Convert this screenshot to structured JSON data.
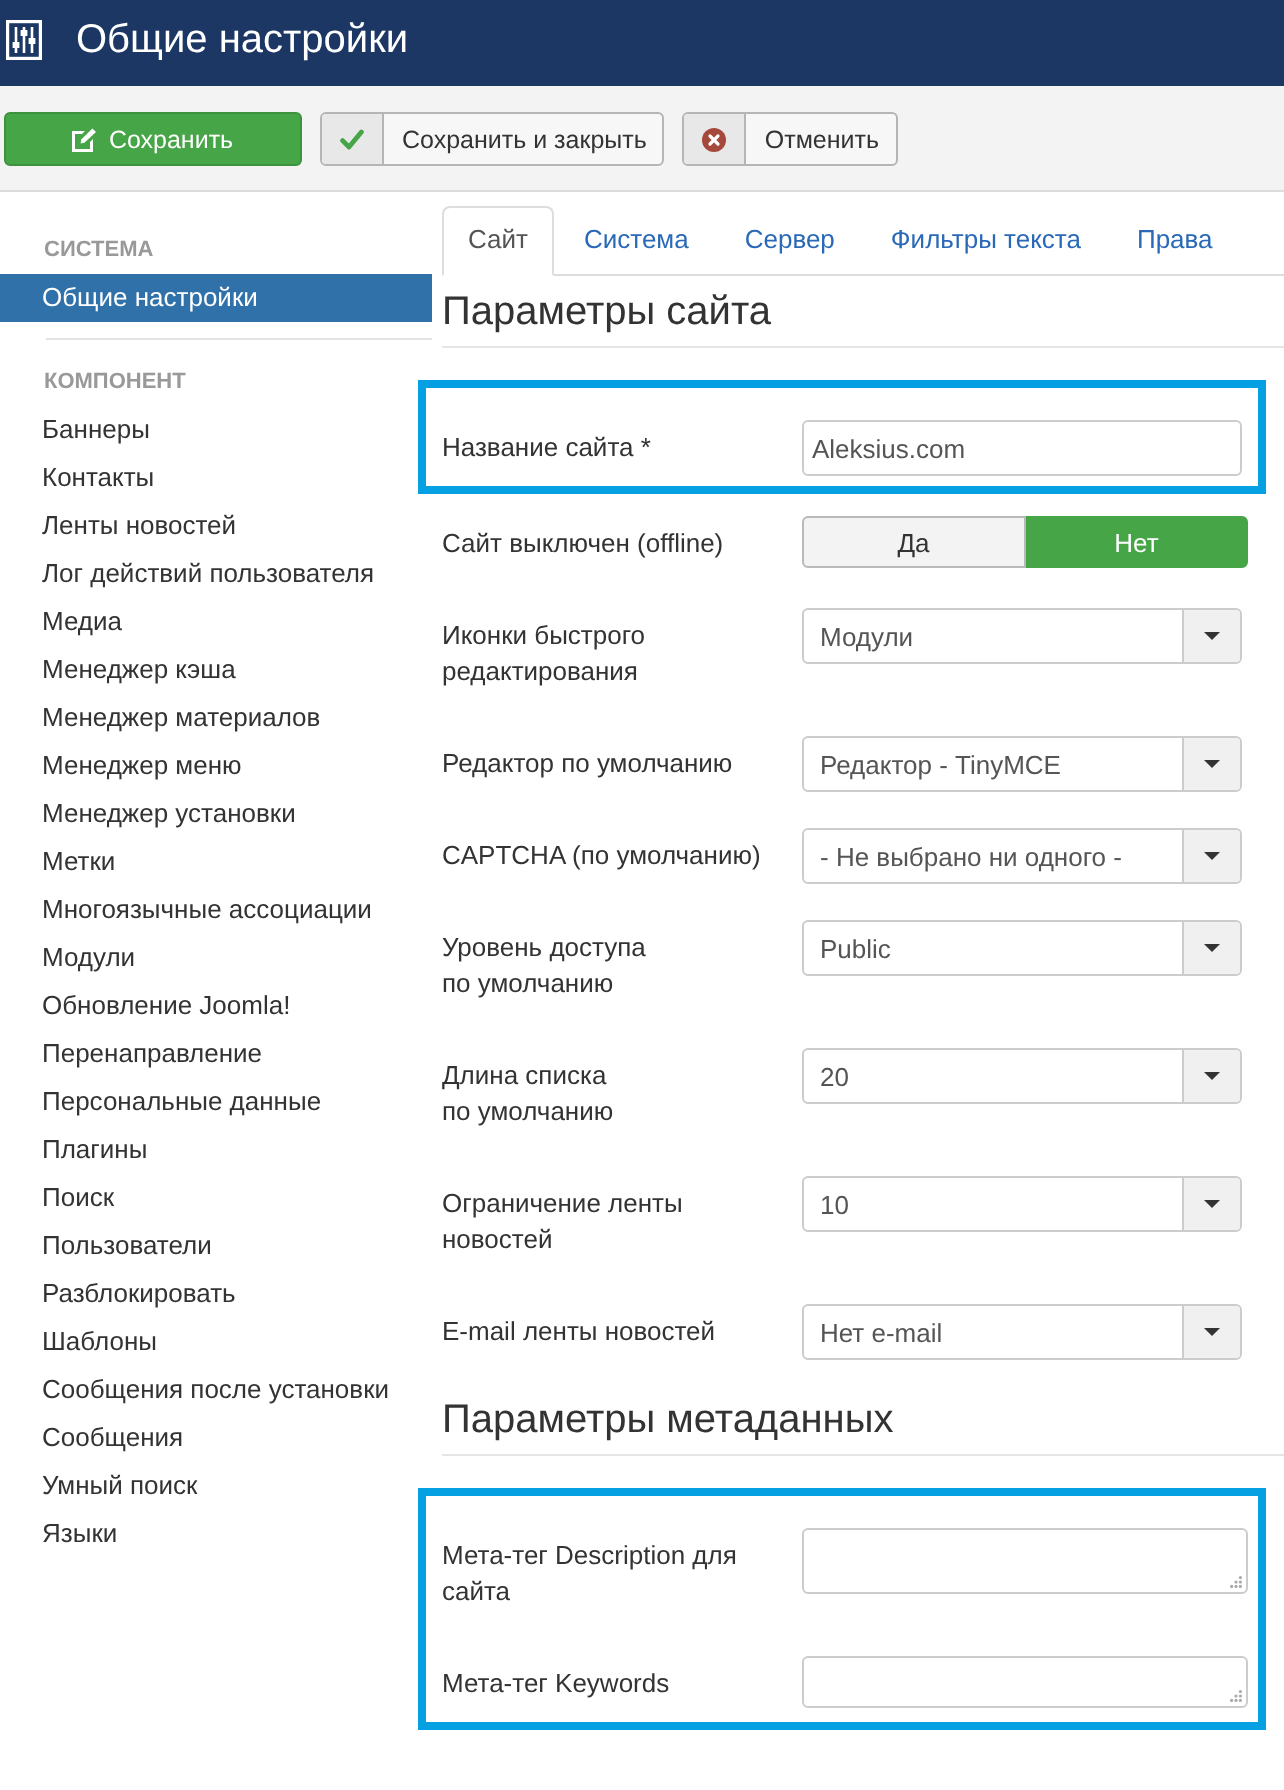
{
  "header": {
    "title": "Общие настройки"
  },
  "toolbar": {
    "buttons": [
      {
        "kind": "primary",
        "label": "Сохранить"
      },
      {
        "kind": "check",
        "label": "Сохранить и закрыть"
      },
      {
        "kind": "cancel",
        "label": "Отменить"
      }
    ]
  },
  "sidebar": {
    "groups": [
      {
        "heading": "СИСТЕМА",
        "items": [
          {
            "label": "Общие настройки",
            "selected": true
          }
        ]
      },
      {
        "heading": "КОМПОНЕНТ",
        "items": [
          {
            "label": "Баннеры",
            "selected": false
          },
          {
            "label": "Контакты",
            "selected": false
          },
          {
            "label": "Ленты новостей",
            "selected": false
          },
          {
            "label": "Лог действий пользователя",
            "selected": false
          },
          {
            "label": "Медиа",
            "selected": false
          },
          {
            "label": "Менеджер кэша",
            "selected": false
          },
          {
            "label": "Менеджер материалов",
            "selected": false
          },
          {
            "label": "Менеджер меню",
            "selected": false
          },
          {
            "label": "Менеджер установки",
            "selected": false
          },
          {
            "label": "Метки",
            "selected": false
          },
          {
            "label": "Многоязычные ассоциации",
            "selected": false
          },
          {
            "label": "Модули",
            "selected": false
          },
          {
            "label": "Обновление Joomla!",
            "selected": false
          },
          {
            "label": "Перенаправление",
            "selected": false
          },
          {
            "label": "Персональные данные",
            "selected": false
          },
          {
            "label": "Плагины",
            "selected": false
          },
          {
            "label": "Поиск",
            "selected": false
          },
          {
            "label": "Пользователи",
            "selected": false
          },
          {
            "label": "Разблокировать",
            "selected": false
          },
          {
            "label": "Шаблоны",
            "selected": false
          },
          {
            "label": "Сообщения после установки",
            "selected": false
          },
          {
            "label": "Сообщения",
            "selected": false
          },
          {
            "label": "Умный поиск",
            "selected": false
          },
          {
            "label": "Языки",
            "selected": false
          }
        ]
      }
    ]
  },
  "tabs": [
    {
      "label": "Сайт",
      "selected": true
    },
    {
      "label": "Система",
      "selected": false
    },
    {
      "label": "Сервер",
      "selected": false
    },
    {
      "label": "Фильтры текста",
      "selected": false
    },
    {
      "label": "Права",
      "selected": false
    }
  ],
  "sections": [
    {
      "title": "Параметры сайта",
      "groups": [
        {
          "highlighted": true,
          "fields": [
            {
              "kind": "text",
              "label": "Название сайта *",
              "value": "Aleksius.com"
            }
          ]
        },
        {
          "highlighted": false,
          "fields": [
            {
              "kind": "toggle",
              "label": "Сайт выключен (offline)",
              "options": [
                {
                  "label": "Да",
                  "selected": false
                },
                {
                  "label": "Нет",
                  "selected": true
                }
              ]
            },
            {
              "kind": "select",
              "label": "Иконки быстрого\nредактирования",
              "value": "Модули"
            },
            {
              "kind": "select",
              "label": "Редактор по умолчанию",
              "value": "Редактор - TinyMCE"
            },
            {
              "kind": "select",
              "label": "CAPTCHA (по умолчанию)",
              "value": "- Не выбрано ни одного -"
            },
            {
              "kind": "select",
              "label": "Уровень доступа\nпо умолчанию",
              "value": "Public"
            },
            {
              "kind": "select",
              "label": "Длина списка\nпо умолчанию",
              "value": "20"
            },
            {
              "kind": "select",
              "label": "Ограничение ленты\nновостей",
              "value": "10"
            },
            {
              "kind": "select",
              "label": "E-mail ленты новостей",
              "value": "Нет e-mail"
            }
          ]
        }
      ]
    },
    {
      "title": "Параметры метаданных",
      "groups": [
        {
          "highlighted": true,
          "fields": [
            {
              "kind": "textarea",
              "label": "Мета-тег Description для\nсайта"
            },
            {
              "kind": "textarea",
              "label": "Мета-тег Keywords"
            }
          ]
        }
      ]
    }
  ]
}
